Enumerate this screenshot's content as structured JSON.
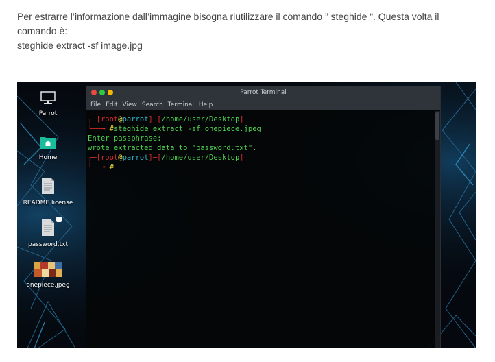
{
  "article": {
    "line1": "Per estrarre l’informazione dall’immagine bisogna riutilizzare il comando ” steghide “. Questa volta il",
    "line2": "comando è:",
    "line3": "steghide extract -sf image.jpg"
  },
  "desktop": {
    "icons": [
      {
        "label": "Parrot",
        "icon": "monitor-icon"
      },
      {
        "label": "Home",
        "icon": "home-folder-icon"
      },
      {
        "label": "README.license",
        "icon": "text-file-icon"
      },
      {
        "label": "password.txt",
        "icon": "text-file-icon"
      },
      {
        "label": "onepiece.jpeg",
        "icon": "image-thumbnail-icon"
      }
    ]
  },
  "terminal": {
    "title": "Parrot Terminal",
    "menu": [
      "File",
      "Edit",
      "View",
      "Search",
      "Terminal",
      "Help"
    ],
    "prompt": {
      "open": "┌─[",
      "user": "root",
      "at": "@",
      "host": "parrot",
      "sep": "]─[",
      "path": "/home/user/Desktop",
      "close": "]",
      "arrow": "└──╼ ",
      "hash": "#"
    },
    "command": "steghide extract -sf onepiece.jpeg",
    "output": [
      "Enter passphrase:",
      "wrote extracted data to \"password.txt\"."
    ]
  },
  "colors": {
    "prompt_bracket": "#d22b2b",
    "prompt_user_host": "#e9d43b",
    "prompt_path": "#2fb5c8",
    "command_text": "#4fd14f",
    "titlebar": "#2f343a"
  }
}
